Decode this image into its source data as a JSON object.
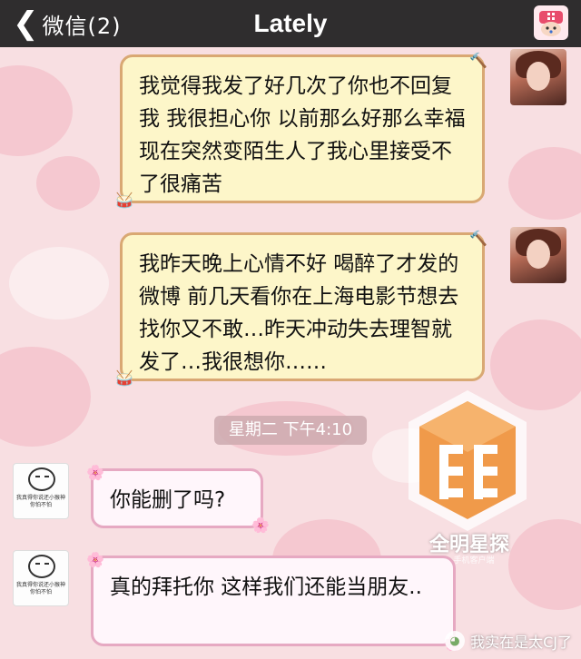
{
  "header": {
    "back_chevron": "❮",
    "back_label": "微信(2)",
    "title": "Lately",
    "avatar_icon": "chopper-avatar-icon"
  },
  "messages": [
    {
      "side": "out",
      "text": "我觉得我发了好几次了你也不回复我 我很担心你 以前那么好那么幸福 现在突然变陌生人了我心里接受不了很痛苦"
    },
    {
      "side": "out",
      "text": "我昨天晚上心情不好 喝醉了才发的微博 前几天看你在上海电影节想去找你又不敢…昨天冲动失去理智就发了…我很想你……"
    },
    {
      "side": "in",
      "text": "你能删了吗?"
    },
    {
      "side": "in",
      "text": "真的拜托你 这样我们还能当朋友.."
    }
  ],
  "timestamp": "星期二 下午4:10",
  "meme_caption": "我真得你说还小猴神你怕不怕",
  "watermark_logo": {
    "name": "全明星探",
    "sub": "手机客户端"
  },
  "watermark_account": "我实在是太CJ了",
  "colors": {
    "header_bg": "#2f2d2e",
    "out_bubble": "#fdf6c9",
    "out_border": "#d9a873",
    "in_bubble": "#fff6fb",
    "in_border": "#e6a9c2",
    "wallpaper": "#f8dfe2"
  }
}
